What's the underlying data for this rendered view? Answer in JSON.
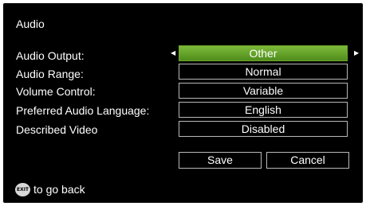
{
  "title": "Audio",
  "settings": [
    {
      "label": "Audio Output:",
      "value": "Other",
      "selected": true
    },
    {
      "label": "Audio Range:",
      "value": "Normal",
      "selected": false
    },
    {
      "label": "Volume Control:",
      "value": "Variable",
      "selected": false
    },
    {
      "label": "Preferred Audio Language:",
      "value": "English",
      "selected": false
    },
    {
      "label": "Described Video",
      "value": "Disabled",
      "selected": false
    }
  ],
  "arrows": {
    "left": "◀",
    "right": "▶"
  },
  "buttons": {
    "save": "Save",
    "cancel": "Cancel"
  },
  "footer": {
    "exit_icon_label": "EXIT",
    "hint": "to go back"
  },
  "colors": {
    "background": "#000000",
    "selected_green": "#6aa62b",
    "border": "#b9b9b9",
    "text": "#ffffff"
  }
}
